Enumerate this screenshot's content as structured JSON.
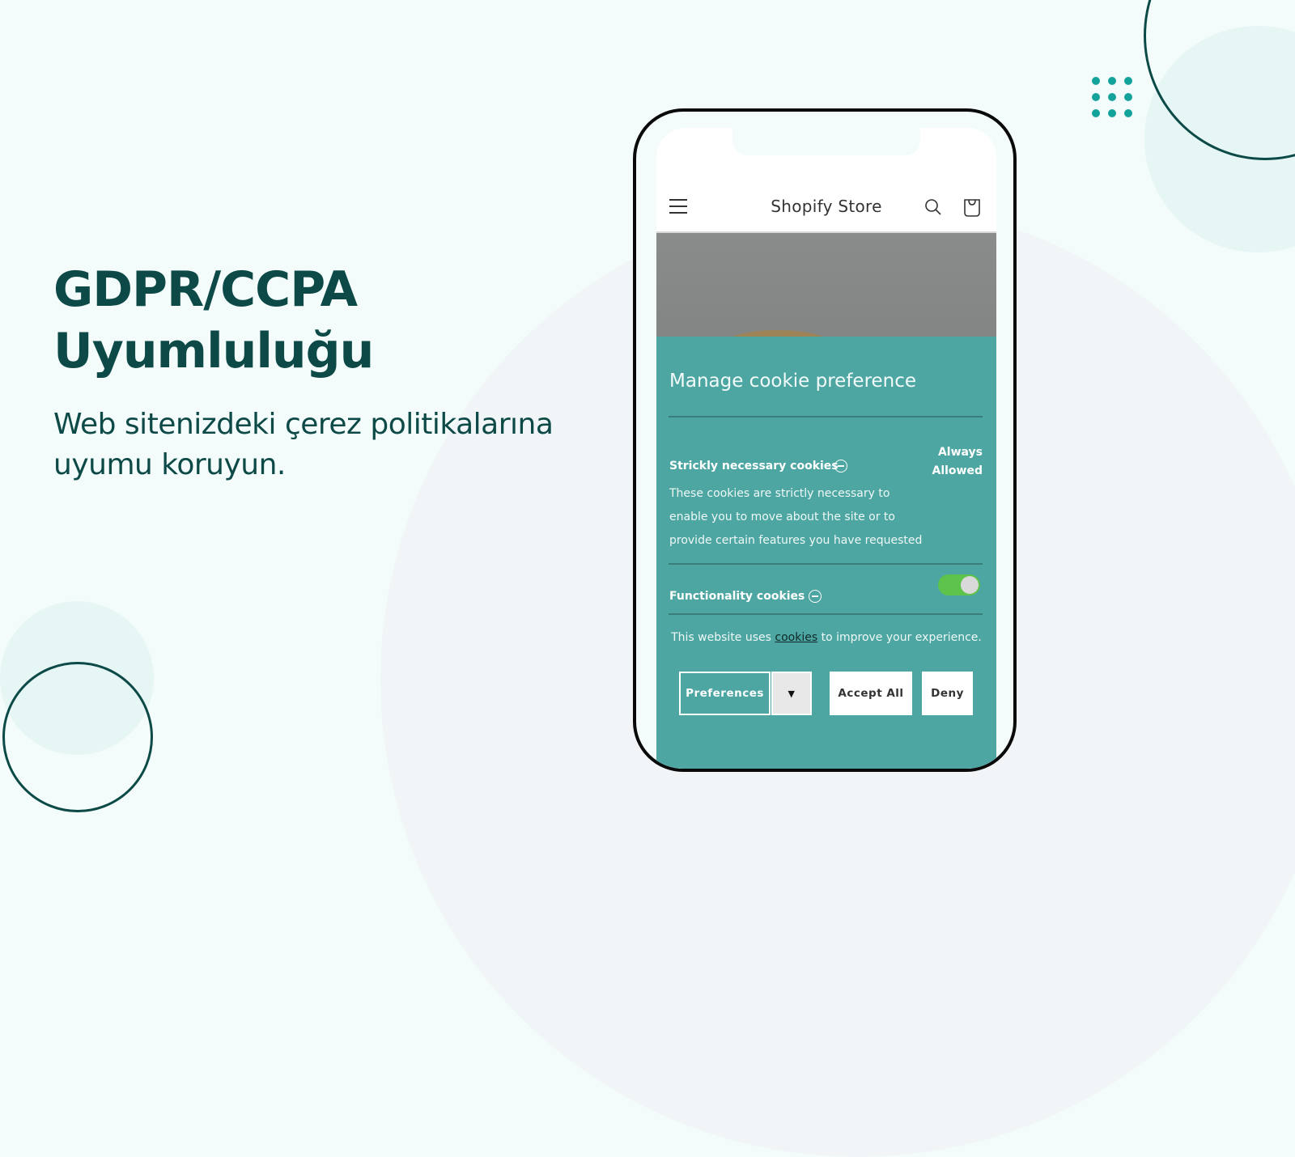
{
  "headline": {
    "line1": "GDPR/CCPA",
    "line2": "Uyumluluğu"
  },
  "subheadline": "Web sitenizdeki çerez politikalarına uyumu koruyun.",
  "colors": {
    "brand_dark": "#0d4a47",
    "accent_teal": "#14a39a",
    "cookie_panel": "#4da6a2",
    "toggle_on": "#5dc34a"
  },
  "store": {
    "title": "Shopify Store",
    "icons": [
      "hamburger-menu-icon",
      "search-icon",
      "cart-icon"
    ]
  },
  "cookie_panel": {
    "title": "Manage cookie preference",
    "sections": [
      {
        "title": "Strickly necessary cookies",
        "status": "Always Allowed",
        "status_line1": "Always",
        "status_line2": "Allowed",
        "description": "These cookies are strictly necessary to enable you to move about the site or to provide certain features you have requested",
        "icon": "collapse-minus-icon"
      },
      {
        "title": "Functionality cookies",
        "toggle_on": true,
        "icon": "collapse-minus-icon"
      }
    ],
    "notice_prefix": "This website uses",
    "notice_link": "cookies",
    "notice_suffix": "to improve your experience.",
    "buttons": {
      "preferences": "Preferences",
      "dropdown_glyph": "▼",
      "accept_all": "Accept All",
      "deny": "Deny"
    }
  }
}
